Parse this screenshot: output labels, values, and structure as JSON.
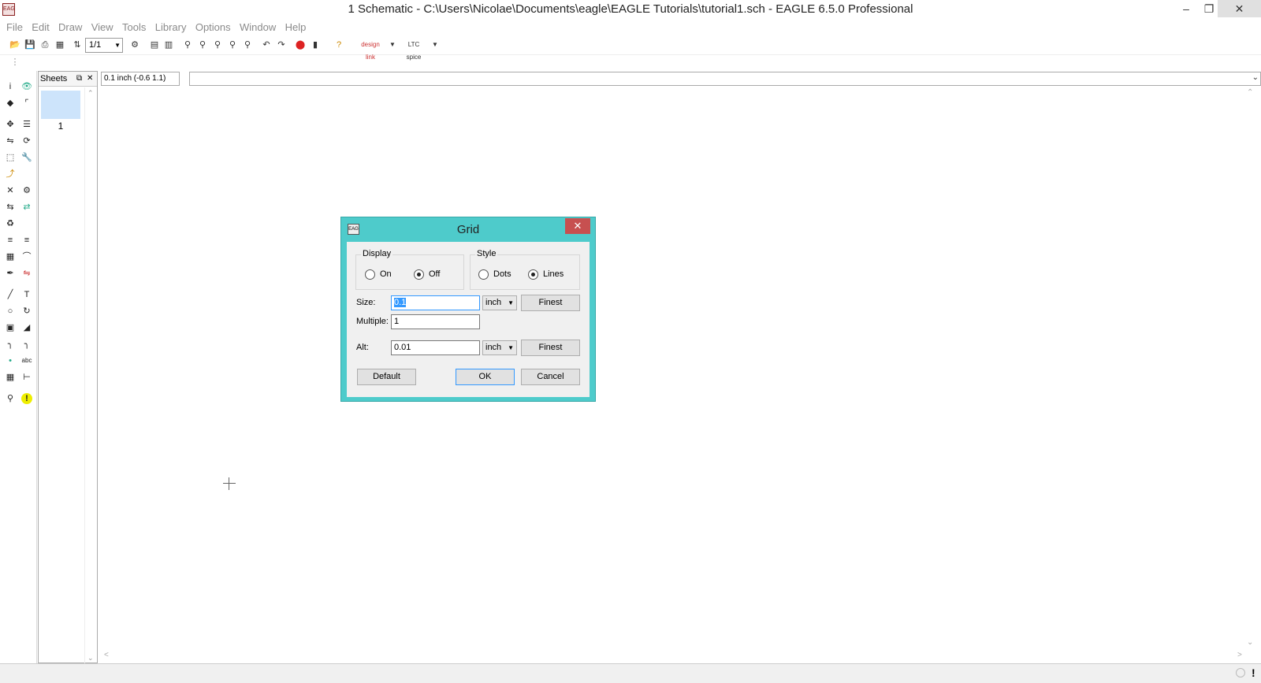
{
  "window": {
    "title": "1 Schematic - C:\\Users\\Nicolae\\Documents\\eagle\\EAGLE Tutorials\\tutorial1.sch - EAGLE 6.5.0 Professional",
    "min": "–",
    "max": "❐",
    "close": "✕"
  },
  "menu": [
    "File",
    "Edit",
    "Draw",
    "View",
    "Tools",
    "Library",
    "Options",
    "Window",
    "Help"
  ],
  "toolbar": {
    "sheet_value": "1/1",
    "designlink_label": "design link",
    "ltc_label": "LTC spice"
  },
  "command": {
    "coordinates": "0.1 inch (-0.6 1.1)",
    "input_value": ""
  },
  "sheets": {
    "title": "Sheets",
    "items": [
      "1"
    ]
  },
  "dialog": {
    "title": "Grid",
    "close": "✕",
    "display": {
      "label": "Display",
      "on_label": "On",
      "off_label": "Off",
      "selected": "Off"
    },
    "style": {
      "label": "Style",
      "dots_label": "Dots",
      "lines_label": "Lines",
      "selected": "Lines"
    },
    "size": {
      "label": "Size:",
      "value": "0.1",
      "unit": "inch",
      "finest_label": "Finest"
    },
    "multiple": {
      "label": "Multiple:",
      "value": "1"
    },
    "alt": {
      "label": "Alt:",
      "value": "0.01",
      "unit": "inch",
      "finest_label": "Finest"
    },
    "buttons": {
      "default": "Default",
      "ok": "OK",
      "cancel": "Cancel"
    }
  },
  "colors": {
    "dialog_frame": "#4ecbcb",
    "dialog_close": "#c75050",
    "selection": "#3399ff",
    "sheet_thumb": "#cde4fb"
  }
}
